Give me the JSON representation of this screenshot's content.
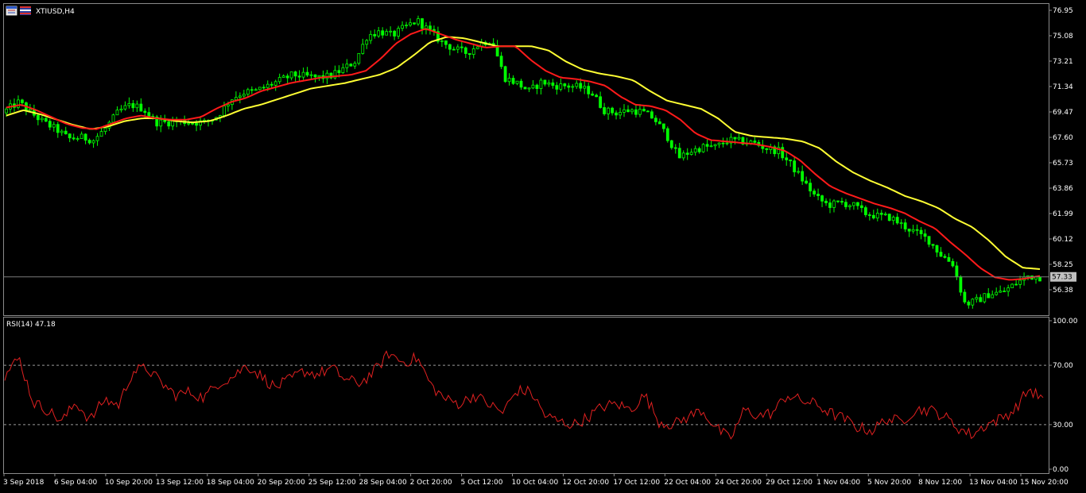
{
  "colors": {
    "background": "#000000",
    "bull_candle": "#00ff00",
    "bear_candle": "#00ff00",
    "ma_fast": "#ff1a1a",
    "ma_slow": "#ffff33",
    "rsi_line": "#e02020",
    "price_line": "#7a7a7a",
    "price_tag_bg": "#c0c0c0",
    "axis_text": "#ffffff",
    "frame": "#8a8a8a"
  },
  "header": {
    "symbol_label": "XTIUSD,H4",
    "icons": [
      "chart-window-icon",
      "symbol-flag-icon"
    ]
  },
  "price_pane": {
    "current_price_label": "57.33",
    "y_ticks": [
      "76.95",
      "75.08",
      "73.21",
      "71.34",
      "69.47",
      "67.60",
      "65.73",
      "63.86",
      "61.99",
      "60.12",
      "58.25",
      "56.38"
    ]
  },
  "rsi_pane": {
    "label": "RSI(14) 47.18",
    "y_ticks": [
      "100.00",
      "70.00",
      "30.00",
      "0.00"
    ]
  },
  "x_axis": {
    "labels": [
      "3 Sep 2018",
      "6 Sep 04:00",
      "10 Sep 20:00",
      "13 Sep 12:00",
      "18 Sep 04:00",
      "20 Sep 20:00",
      "25 Sep 12:00",
      "28 Sep 04:00",
      "2 Oct 20:00",
      "5 Oct 12:00",
      "10 Oct 04:00",
      "12 Oct 20:00",
      "17 Oct 12:00",
      "22 Oct 04:00",
      "24 Oct 20:00",
      "29 Oct 12:00",
      "1 Nov 04:00",
      "5 Nov 20:00",
      "8 Nov 12:00",
      "13 Nov 04:00",
      "15 Nov 20:00"
    ]
  },
  "chart_data": [
    {
      "type": "candlestick",
      "title": "XTIUSD,H4",
      "ylim": [
        55.0,
        77.3
      ],
      "y_ticks": [
        76.95,
        75.08,
        73.21,
        71.34,
        69.47,
        67.6,
        65.73,
        63.86,
        61.99,
        60.12,
        58.25,
        56.38
      ],
      "current_price": 57.33,
      "x_labels": [
        "3 Sep 2018",
        "6 Sep 04:00",
        "10 Sep 20:00",
        "13 Sep 12:00",
        "18 Sep 04:00",
        "20 Sep 20:00",
        "25 Sep 12:00",
        "28 Sep 04:00",
        "2 Oct 20:00",
        "5 Oct 12:00",
        "10 Oct 04:00",
        "12 Oct 20:00",
        "17 Oct 12:00",
        "22 Oct 04:00",
        "24 Oct 20:00",
        "29 Oct 12:00",
        "1 Nov 04:00",
        "5 Nov 20:00",
        "8 Nov 12:00",
        "13 Nov 04:00",
        "15 Nov 20:00"
      ],
      "close_anchors": [
        69.6,
        70.2,
        69.4,
        68.7,
        68.2,
        67.5,
        67.6,
        67.4,
        68.3,
        69.5,
        70.0,
        69.7,
        68.7,
        68.7,
        68.8,
        68.7,
        68.7,
        69.2,
        70.4,
        70.9,
        71.0,
        71.4,
        71.8,
        72.2,
        72.1,
        72.0,
        72.1,
        72.6,
        73.2,
        75.1,
        75.4,
        75.1,
        75.7,
        76.2,
        75.4,
        74.6,
        74.1,
        73.8,
        74.5,
        74.8,
        72.0,
        71.6,
        71.0,
        71.7,
        71.4,
        71.4,
        71.3,
        70.9,
        69.6,
        69.4,
        69.6,
        69.5,
        69.0,
        67.8,
        66.1,
        66.6,
        66.9,
        66.9,
        67.4,
        67.3,
        67.2,
        66.8,
        66.6,
        65.6,
        64.4,
        63.2,
        62.6,
        62.8,
        62.6,
        62.0,
        61.8,
        61.7,
        61.1,
        60.6,
        60.1,
        59.0,
        58.3,
        55.3,
        55.6,
        56.1,
        56.2,
        56.8,
        57.4,
        57.3
      ],
      "ma_fast_anchors": [
        69.8,
        70.0,
        69.6,
        69.1,
        68.6,
        68.3,
        68.2,
        68.6,
        69.0,
        69.2,
        69.0,
        68.9,
        68.9,
        69.1,
        69.7,
        70.2,
        70.5,
        71.0,
        71.3,
        71.6,
        71.8,
        72.0,
        72.1,
        72.2,
        72.5,
        73.4,
        74.5,
        75.2,
        75.6,
        75.2,
        74.8,
        74.5,
        74.2,
        74.3,
        74.3,
        73.3,
        72.5,
        72.0,
        71.9,
        71.7,
        71.4,
        70.6,
        70.0,
        69.9,
        69.6,
        68.9,
        67.9,
        67.4,
        67.3,
        67.2,
        67.1,
        66.9,
        66.6,
        65.9,
        64.9,
        64.0,
        63.5,
        63.1,
        62.7,
        62.4,
        62.0,
        61.4,
        60.9,
        59.9,
        59.0,
        58.0,
        57.3,
        57.1,
        57.2,
        57.4
      ],
      "ma_slow_anchors": [
        69.2,
        69.6,
        69.3,
        68.9,
        68.5,
        68.2,
        68.4,
        68.8,
        69.0,
        69.0,
        68.8,
        68.7,
        68.8,
        69.2,
        69.7,
        70.0,
        70.4,
        70.8,
        71.2,
        71.4,
        71.6,
        71.9,
        72.2,
        72.7,
        73.6,
        74.6,
        75.0,
        74.9,
        74.6,
        74.3,
        74.3,
        74.3,
        74.0,
        73.2,
        72.6,
        72.3,
        72.1,
        71.8,
        71.0,
        70.3,
        70.0,
        69.7,
        69.0,
        68.0,
        67.7,
        67.6,
        67.5,
        67.3,
        66.8,
        65.8,
        65.0,
        64.4,
        63.9,
        63.3,
        62.9,
        62.4,
        61.6,
        61.0,
        60.0,
        58.8,
        58.0,
        57.9
      ]
    },
    {
      "type": "line",
      "title": "RSI(14) 47.18",
      "ylim": [
        0,
        100
      ],
      "y_ticks": [
        100.0,
        70.0,
        30.0,
        0.0
      ],
      "levels": [
        70,
        30
      ],
      "current_value": 47.18,
      "values_anchors": [
        63,
        75,
        45,
        40,
        32,
        45,
        33,
        47,
        43,
        66,
        68,
        58,
        50,
        52,
        48,
        58,
        62,
        70,
        63,
        55,
        60,
        66,
        64,
        68,
        60,
        58,
        66,
        78,
        72,
        75,
        56,
        47,
        44,
        50,
        44,
        38,
        53,
        52,
        36,
        32,
        30,
        35,
        42,
        44,
        40,
        50,
        32,
        30,
        35,
        40,
        28,
        20,
        40,
        36,
        38,
        50,
        46,
        44,
        38,
        34,
        28,
        26,
        34,
        32,
        40,
        40,
        36,
        28,
        23,
        30,
        34,
        40,
        54,
        47
      ]
    }
  ]
}
